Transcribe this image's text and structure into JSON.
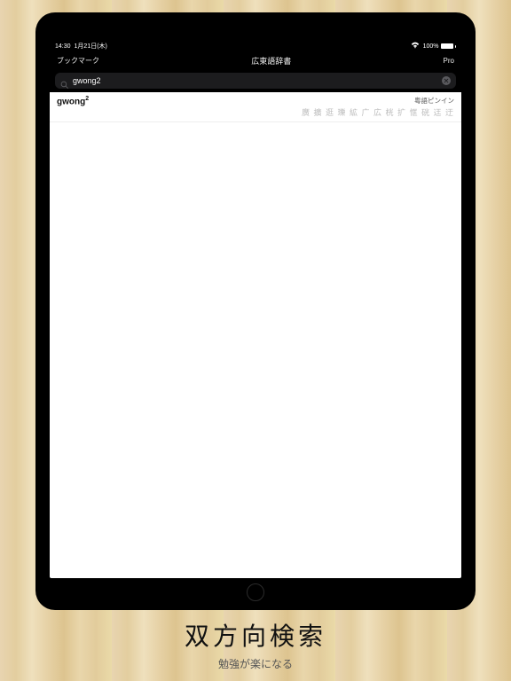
{
  "statusbar": {
    "time": "14:30",
    "date": "1月21日(木)",
    "battery_pct": "100%"
  },
  "navbar": {
    "left": "ブックマーク",
    "title": "広東語辞書",
    "right": "Pro"
  },
  "search": {
    "value": "gwong2",
    "placeholder": ""
  },
  "result": {
    "entry_base": "gwong",
    "entry_sup": "2",
    "reading_label": "粤語ピンイン",
    "kanji_list": "廣 擴 逛 瓅 絋 广 広 桄 扩 恇 硄 迋 迂"
  },
  "caption": {
    "title": "双方向検索",
    "subtitle": "勉強が楽になる"
  }
}
